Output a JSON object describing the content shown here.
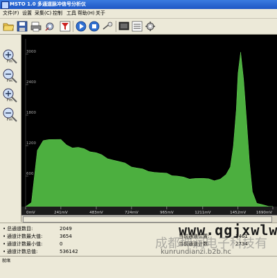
{
  "window": {
    "title": "MSTO 1.0  多通道脉冲信号分析仪"
  },
  "menu": [
    "文件(F)",
    "设置",
    "采集(C)",
    "控制",
    "工具",
    "帮助(H)",
    "关于"
  ],
  "toolbar": {
    "buttons": [
      "open-icon",
      "save-icon",
      "print-icon",
      "settings-icon",
      "filter-icon",
      "play-icon",
      "stop-icon",
      "pause-icon",
      "display-icon",
      "list-icon",
      "config-icon"
    ]
  },
  "sidebar": {
    "zoom_label": "Fm"
  },
  "chart_data": {
    "type": "area",
    "x_ticks": [
      "0mV",
      "241mV",
      "483mV",
      "724mV",
      "965mV",
      "1211mV",
      "1452mV",
      "1690mV"
    ],
    "y_ticks": [
      "3000",
      "2400",
      "1800",
      "1200",
      "600"
    ],
    "xlim": [
      0,
      1690
    ],
    "ylim": [
      0,
      3300
    ],
    "grid": false,
    "x": [
      0,
      40,
      80,
      120,
      160,
      200,
      241,
      280,
      320,
      360,
      400,
      440,
      483,
      520,
      560,
      600,
      640,
      680,
      724,
      760,
      800,
      840,
      880,
      920,
      965,
      1000,
      1040,
      1080,
      1120,
      1160,
      1211,
      1250,
      1290,
      1330,
      1370,
      1400,
      1420,
      1440,
      1452,
      1470,
      1490,
      1510,
      1530,
      1550,
      1580,
      1620,
      1660,
      1690
    ],
    "values": [
      0,
      80,
      1100,
      1280,
      1330,
      1320,
      1310,
      1230,
      1160,
      1160,
      1120,
      1090,
      1060,
      1010,
      960,
      920,
      880,
      840,
      790,
      760,
      730,
      710,
      680,
      660,
      640,
      620,
      600,
      570,
      560,
      560,
      550,
      530,
      520,
      540,
      620,
      800,
      1200,
      1900,
      2600,
      3050,
      2500,
      1700,
      900,
      300,
      60,
      20,
      5,
      0
    ],
    "fill_color": "#4caf3f",
    "background": "#000000"
  },
  "info": {
    "rows_left": [
      {
        "label": "总通道数目:",
        "value": "2049"
      },
      {
        "label": "通道计数最大值:",
        "value": "3654"
      },
      {
        "label": "通道计数最小值:",
        "value": "0"
      },
      {
        "label": "通道计数总值:",
        "value": "536142"
      }
    ],
    "rows_right": [
      {
        "label": "当前通道位置:",
        "value": "1461"
      },
      {
        "label": "当前通道计数:",
        "value": "2734"
      }
    ]
  },
  "watermark": {
    "url": "www.qgjxwlw",
    "company": "成都坤润电子科技有",
    "domain": "kunrundianzi.b2b.hc"
  },
  "status": {
    "text": "就绪"
  }
}
